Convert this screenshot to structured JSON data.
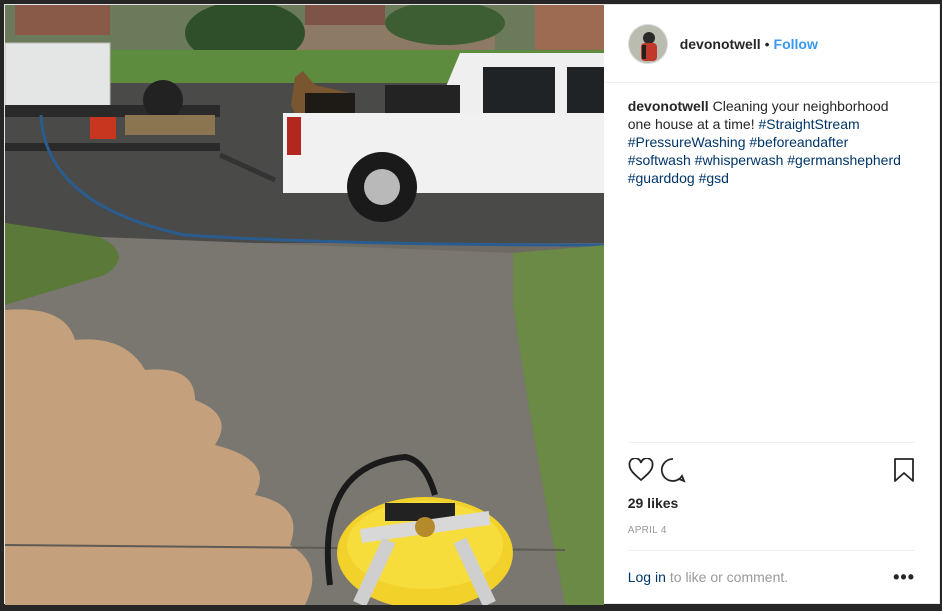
{
  "post": {
    "username": "devonotwell",
    "separator": "•",
    "follow_label": "Follow",
    "caption_user": "devonotwell",
    "caption_text_1": "Cleaning your neighborhood one house at a time! ",
    "hashtags": [
      "#StraightStream",
      "#PressureWashing",
      "#beforeandafter",
      "#softwash",
      "#whisperwash",
      "#germanshepherd",
      "#guarddog",
      "#gsd"
    ],
    "likes": "29 likes",
    "date": "APRIL 4",
    "login_label": "Log in",
    "comment_prompt": "to like or comment.",
    "more_label": "•••"
  },
  "icons": {
    "like": "heart-icon",
    "comment": "comment-icon",
    "save": "bookmark-icon",
    "more": "more-options-icon"
  },
  "colors": {
    "link_blue": "#3897f0",
    "hashtag": "#003569",
    "text": "#262626",
    "muted": "#999999",
    "surface_cleaner": "#f2d12a"
  }
}
